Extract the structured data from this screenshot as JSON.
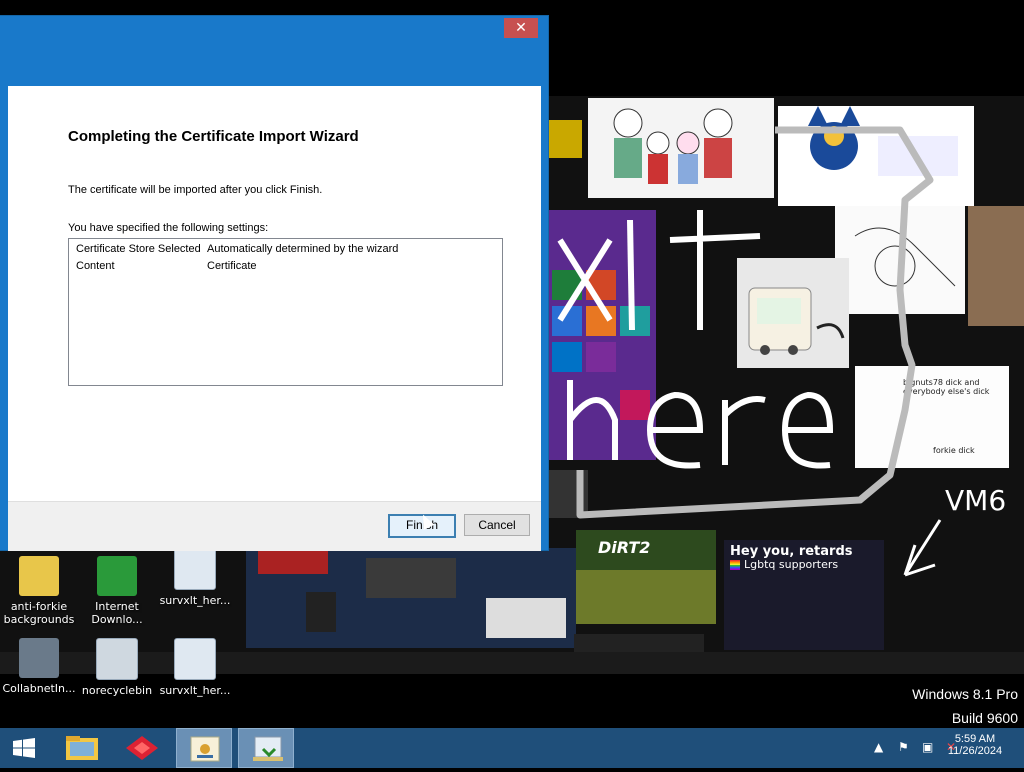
{
  "window": {
    "close_glyph": "✕",
    "wizard_title": "Completing the Certificate Import Wizard",
    "intro_text": "The certificate will be imported after you click Finish.",
    "settings_label": "You have specified the following settings:",
    "settings": [
      {
        "key": "Certificate Store Selected",
        "value": "Automatically determined by the wizard"
      },
      {
        "key": "Content",
        "value": "Certificate"
      }
    ],
    "finish_label": "Finish",
    "cancel_label": "Cancel"
  },
  "desktop_icons": [
    {
      "label_line1": "anti-forkie",
      "label_line2": "backgrounds",
      "icon": "folder-icon"
    },
    {
      "label_line1": "Internet",
      "label_line2": "Downlo...",
      "icon": "download-manager-icon"
    },
    {
      "label_line1": "survxlt_her...",
      "label_line2": "",
      "icon": "file-icon"
    },
    {
      "label_line1": "CollabnetIn...",
      "label_line2": "",
      "icon": "computer-icon"
    },
    {
      "label_line1": "norecyclebin",
      "label_line2": "",
      "icon": "gear-icon"
    },
    {
      "label_line1": "survxlt_her...",
      "label_line2": "",
      "icon": "file-icon"
    }
  ],
  "wallpaper_text": {
    "scribble": "xlt here",
    "vm_tag": "VM6",
    "hey_you": "Hey you, retards",
    "lgbtq": "Lgbtq supporters",
    "note": "bignuts78 dick and everybody else's dick",
    "forkie": "forkie dick",
    "dirt": "DiRT2"
  },
  "watermark": {
    "line1": "Windows 8.1 Pro",
    "line2": "Build 9600"
  },
  "taskbar": {
    "items": [
      "start-button",
      "file-explorer",
      "red-app",
      "certificate-manager",
      "certificate-import-wizard"
    ],
    "clock_time": "5:59 AM",
    "clock_date": "11/26/2024"
  }
}
